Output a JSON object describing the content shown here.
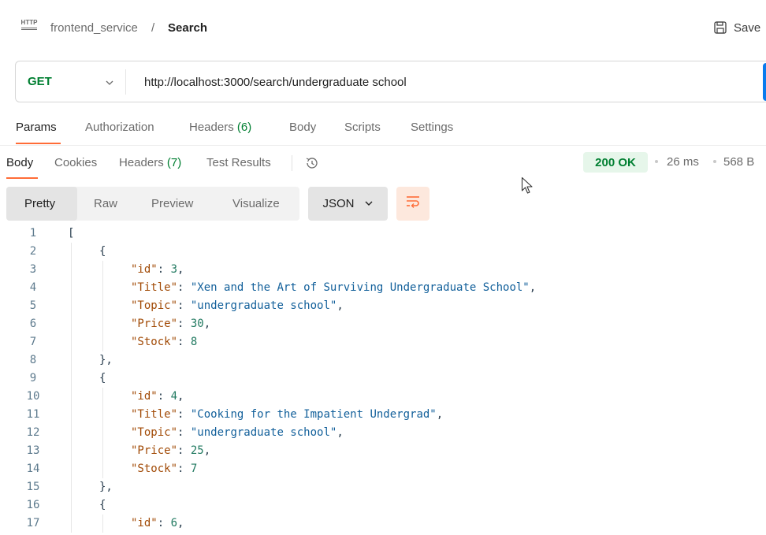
{
  "header": {
    "http_badge": "HTTP",
    "breadcrumb_parent": "frontend_service",
    "breadcrumb_separator": "/",
    "breadcrumb_current": "Search",
    "save_label": "Save"
  },
  "request": {
    "method": "GET",
    "url": "http://localhost:3000/search/undergraduate school"
  },
  "request_tabs": [
    {
      "label": "Params"
    },
    {
      "label": "Authorization"
    },
    {
      "label": "Headers",
      "count": "(6)"
    },
    {
      "label": "Body"
    },
    {
      "label": "Scripts"
    },
    {
      "label": "Settings"
    }
  ],
  "response_tabs": [
    {
      "label": "Body"
    },
    {
      "label": "Cookies"
    },
    {
      "label": "Headers",
      "count": "(7)"
    },
    {
      "label": "Test Results"
    }
  ],
  "response_meta": {
    "status": "200 OK",
    "time": "26 ms",
    "size": "568 B"
  },
  "view_modes": [
    "Pretty",
    "Raw",
    "Preview",
    "Visualize"
  ],
  "format": "JSON",
  "colors": {
    "method": "#007f31",
    "accent": "#ff6c37",
    "send": "#097bed",
    "status_bg": "#e6f6ea"
  },
  "icons": {
    "http": "http-icon",
    "save": "save-icon",
    "method_dropdown": "chevron-down-icon",
    "history": "history-icon",
    "format_dropdown": "chevron-down-icon",
    "wrap": "wrap-lines-icon",
    "cursor": "mouse-pointer-icon"
  },
  "code_lines": [
    {
      "n": "1",
      "indent": 0,
      "tokens": [
        {
          "t": "p",
          "v": "["
        }
      ]
    },
    {
      "n": "2",
      "indent": 1,
      "tokens": [
        {
          "t": "p",
          "v": "{"
        }
      ]
    },
    {
      "n": "3",
      "indent": 2,
      "tokens": [
        {
          "t": "key",
          "v": "\"id\""
        },
        {
          "t": "p",
          "v": ": "
        },
        {
          "t": "num",
          "v": "3"
        },
        {
          "t": "p",
          "v": ","
        }
      ]
    },
    {
      "n": "4",
      "indent": 2,
      "tokens": [
        {
          "t": "key",
          "v": "\"Title\""
        },
        {
          "t": "p",
          "v": ": "
        },
        {
          "t": "str",
          "v": "\"Xen and the Art of Surviving Undergraduate School\""
        },
        {
          "t": "p",
          "v": ","
        }
      ]
    },
    {
      "n": "5",
      "indent": 2,
      "tokens": [
        {
          "t": "key",
          "v": "\"Topic\""
        },
        {
          "t": "p",
          "v": ": "
        },
        {
          "t": "str",
          "v": "\"undergraduate school\""
        },
        {
          "t": "p",
          "v": ","
        }
      ]
    },
    {
      "n": "6",
      "indent": 2,
      "tokens": [
        {
          "t": "key",
          "v": "\"Price\""
        },
        {
          "t": "p",
          "v": ": "
        },
        {
          "t": "num",
          "v": "30"
        },
        {
          "t": "p",
          "v": ","
        }
      ]
    },
    {
      "n": "7",
      "indent": 2,
      "tokens": [
        {
          "t": "key",
          "v": "\"Stock\""
        },
        {
          "t": "p",
          "v": ": "
        },
        {
          "t": "num",
          "v": "8"
        }
      ]
    },
    {
      "n": "8",
      "indent": 1,
      "tokens": [
        {
          "t": "p",
          "v": "},"
        }
      ]
    },
    {
      "n": "9",
      "indent": 1,
      "tokens": [
        {
          "t": "p",
          "v": "{"
        }
      ]
    },
    {
      "n": "10",
      "indent": 2,
      "tokens": [
        {
          "t": "key",
          "v": "\"id\""
        },
        {
          "t": "p",
          "v": ": "
        },
        {
          "t": "num",
          "v": "4"
        },
        {
          "t": "p",
          "v": ","
        }
      ]
    },
    {
      "n": "11",
      "indent": 2,
      "tokens": [
        {
          "t": "key",
          "v": "\"Title\""
        },
        {
          "t": "p",
          "v": ": "
        },
        {
          "t": "str",
          "v": "\"Cooking for the Impatient Undergrad\""
        },
        {
          "t": "p",
          "v": ","
        }
      ]
    },
    {
      "n": "12",
      "indent": 2,
      "tokens": [
        {
          "t": "key",
          "v": "\"Topic\""
        },
        {
          "t": "p",
          "v": ": "
        },
        {
          "t": "str",
          "v": "\"undergraduate school\""
        },
        {
          "t": "p",
          "v": ","
        }
      ]
    },
    {
      "n": "13",
      "indent": 2,
      "tokens": [
        {
          "t": "key",
          "v": "\"Price\""
        },
        {
          "t": "p",
          "v": ": "
        },
        {
          "t": "num",
          "v": "25"
        },
        {
          "t": "p",
          "v": ","
        }
      ]
    },
    {
      "n": "14",
      "indent": 2,
      "tokens": [
        {
          "t": "key",
          "v": "\"Stock\""
        },
        {
          "t": "p",
          "v": ": "
        },
        {
          "t": "num",
          "v": "7"
        }
      ]
    },
    {
      "n": "15",
      "indent": 1,
      "tokens": [
        {
          "t": "p",
          "v": "},"
        }
      ]
    },
    {
      "n": "16",
      "indent": 1,
      "tokens": [
        {
          "t": "p",
          "v": "{"
        }
      ]
    },
    {
      "n": "17",
      "indent": 2,
      "tokens": [
        {
          "t": "key",
          "v": "\"id\""
        },
        {
          "t": "p",
          "v": ": "
        },
        {
          "t": "num",
          "v": "6"
        },
        {
          "t": "p",
          "v": ","
        }
      ]
    }
  ]
}
